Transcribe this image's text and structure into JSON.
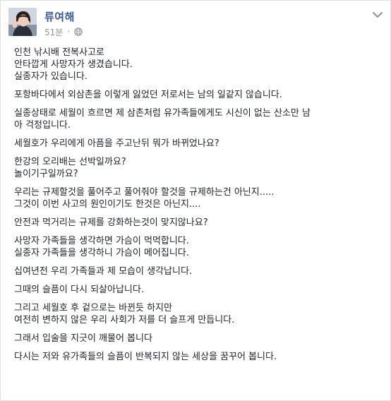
{
  "header": {
    "author_name": "류여해",
    "timestamp": "51분",
    "separator": "·",
    "privacy_icon": "globe-icon",
    "options_icon": "chevron-down-icon"
  },
  "colors": {
    "author_link": "#365899",
    "meta_text": "#90949c",
    "body_text": "#1d2129",
    "border": "#dddfe2"
  },
  "post": {
    "paragraphs": [
      [
        "인천 낚시배 전복사고로",
        "안타깝게 사망자가 생겼습니다.",
        "실종자가 있습니다."
      ],
      [
        "포항바다에서 외삼촌을 이렇게 잃었던 저로서는 남의 일같지 않습니다."
      ],
      [
        "실종상태로 세월이 흐르면 제 삼촌처럼 유가족들에게도 시신이 없는 산소만 남",
        "아 걱정입니다."
      ],
      [
        "세월호가 우리에게 아픔을 주고난뒤 뭐가 바뀌었나요?"
      ],
      [
        "한강의 오리배는 선박일까요?",
        "놀이기구일까요?"
      ],
      [
        "우리는 규제할것을 풀어주고 풀어줘야 할것을 규제하는건 아닌지.....",
        "그것이 이번 사고의 원인이기도 한것은 아닌지...."
      ],
      [
        "안전과 먹거리는 규제를 강화하는것이 맞지않나요?"
      ],
      [
        "사망자 가족들을 생각하면 가슴이 먹먹합니다.",
        "실종자 가족들을 생각하니 가슴이 메어집니다."
      ],
      [
        "십여년전 우리 가족들과 제 모습이 생각납니다."
      ],
      [
        "그때의 슬픔이 다시 되살아납니다."
      ],
      [
        "그리고 세월호 후 겉으로는 바뀐듯 하지만",
        "여전히 변하지 않은 우리 사회가 저를 더 슬프게 만듭니다."
      ],
      [
        "그래서 입술을 지긋이 깨물어 봅니다"
      ],
      [
        "다시는 저와 유가족들의 슬픔이 반복되지 않는 세상을 꿈꾸어 봅니다."
      ]
    ]
  }
}
